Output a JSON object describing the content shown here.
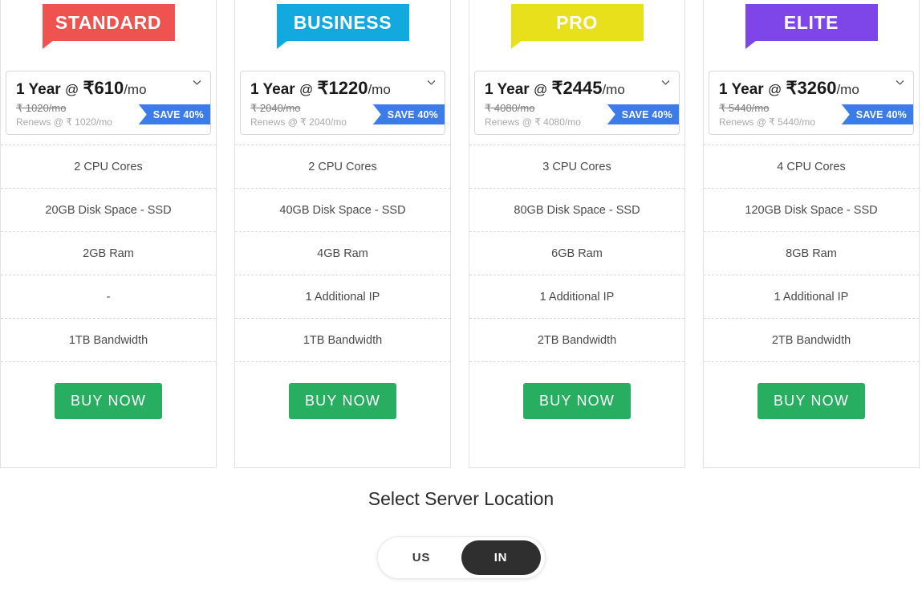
{
  "plans": [
    {
      "name": "STANDARD",
      "color": "#ef5350",
      "term": "1 Year",
      "at": "@",
      "price": "₹610",
      "per": "/mo",
      "old_price": "₹ 1020/mo",
      "renews": "Renews @ ₹ 1020/mo",
      "save_label": "SAVE 40%",
      "features": [
        "2 CPU Cores",
        "20GB Disk Space - SSD",
        "2GB Ram",
        "-",
        "1TB Bandwidth"
      ],
      "buy_label": "BUY NOW"
    },
    {
      "name": "BUSINESS",
      "color": "#11a9de",
      "term": "1 Year",
      "at": "@",
      "price": "₹1220",
      "per": "/mo",
      "old_price": "₹ 2040/mo",
      "renews": "Renews @ ₹ 2040/mo",
      "save_label": "SAVE 40%",
      "features": [
        "2 CPU Cores",
        "40GB Disk Space - SSD",
        "4GB Ram",
        "1 Additional IP",
        "1TB Bandwidth"
      ],
      "buy_label": "BUY NOW"
    },
    {
      "name": "PRO",
      "color": "#e8e01a",
      "term": "1 Year",
      "at": "@",
      "price": "₹2445",
      "per": "/mo",
      "old_price": "₹ 4080/mo",
      "renews": "Renews @ ₹ 4080/mo",
      "save_label": "SAVE 40%",
      "features": [
        "3 CPU Cores",
        "80GB Disk Space - SSD",
        "6GB Ram",
        "1 Additional IP",
        "2TB Bandwidth"
      ],
      "buy_label": "BUY NOW"
    },
    {
      "name": "ELITE",
      "color": "#7e45e8",
      "term": "1 Year",
      "at": "@",
      "price": "₹3260",
      "per": "/mo",
      "old_price": "₹ 5440/mo",
      "renews": "Renews @ ₹ 5440/mo",
      "save_label": "SAVE 40%",
      "features": [
        "4 CPU Cores",
        "120GB Disk Space - SSD",
        "8GB Ram",
        "1 Additional IP",
        "2TB Bandwidth"
      ],
      "buy_label": "BUY NOW"
    }
  ],
  "location": {
    "title": "Select Server Location",
    "options": [
      {
        "label": "US",
        "active": false
      },
      {
        "label": "IN",
        "active": true
      }
    ]
  },
  "icons": {
    "chevron": "chevron-down-icon"
  },
  "colors": {
    "save_ribbon": "#3b7ce8",
    "buy_button": "#27ae60",
    "toggle_active": "#2f2f2f"
  }
}
